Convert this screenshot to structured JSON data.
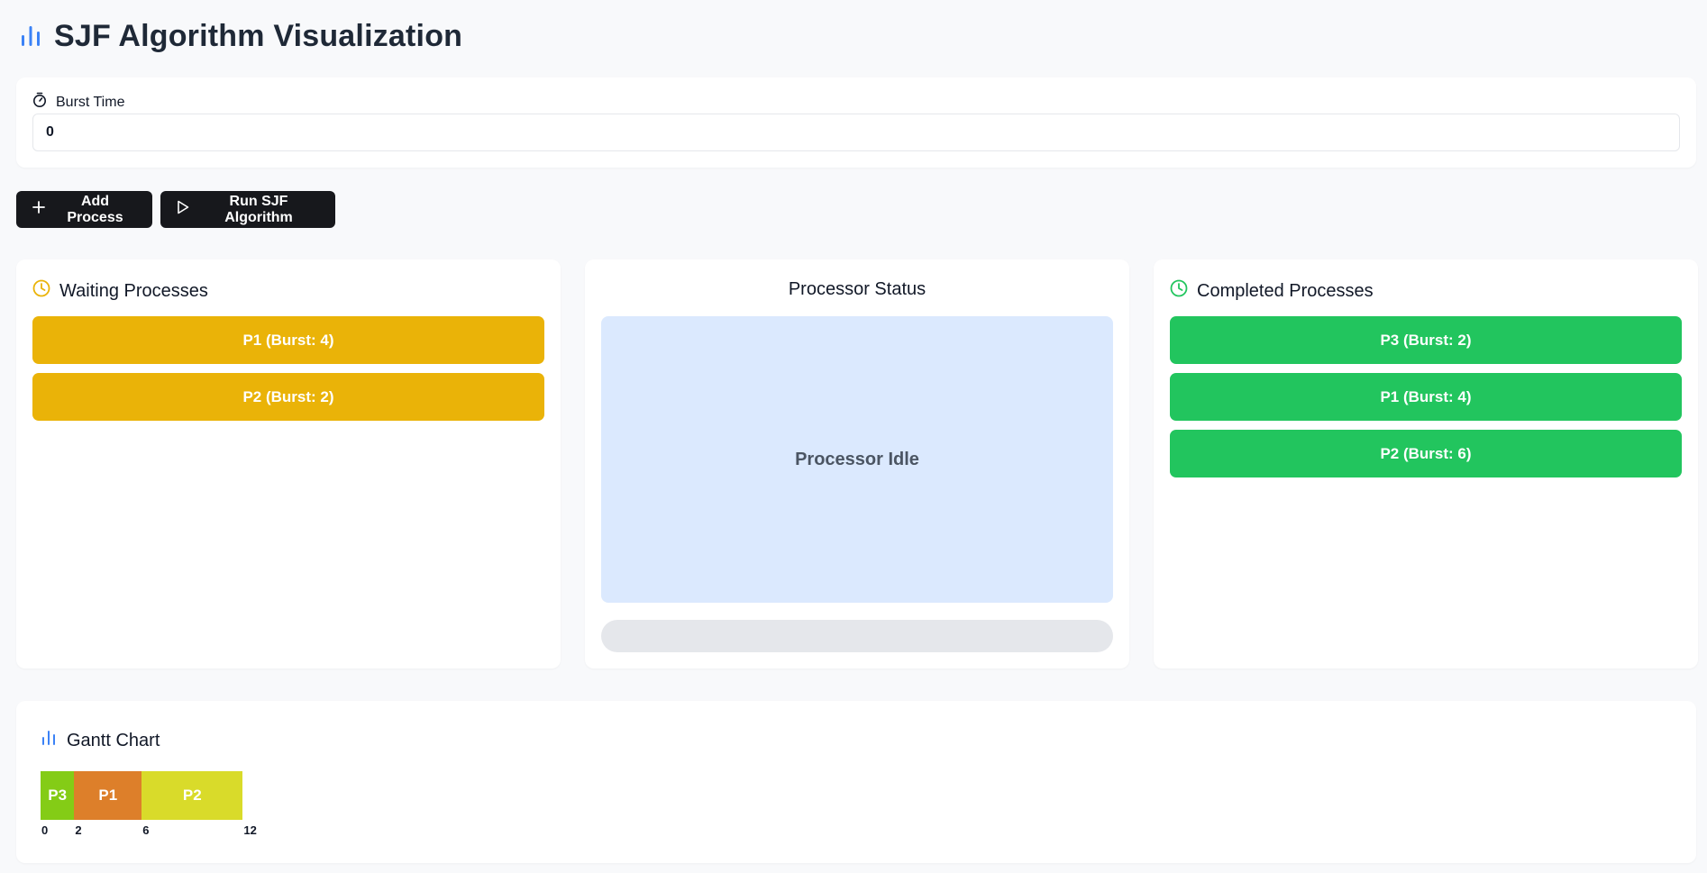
{
  "header": {
    "title": "SJF Algorithm Visualization",
    "icon": "bar-chart-icon"
  },
  "burst_input": {
    "label": "Burst Time",
    "value": "0",
    "icon": "timer-icon"
  },
  "buttons": {
    "add_label": "Add Process",
    "run_label": "Run SJF Algorithm"
  },
  "waiting": {
    "title": "Waiting Processes",
    "color": "#eab308",
    "items": [
      {
        "label": "P1 (Burst: 4)"
      },
      {
        "label": "P2 (Burst: 2)"
      }
    ]
  },
  "processor": {
    "title": "Processor Status",
    "status": "Processor Idle",
    "progress": 0
  },
  "completed": {
    "title": "Completed Processes",
    "color": "#22c55e",
    "items": [
      {
        "label": "P3 (Burst: 2)"
      },
      {
        "label": "P1 (Burst: 4)"
      },
      {
        "label": "P2 (Burst: 6)"
      }
    ]
  },
  "gantt": {
    "title": "Gantt Chart"
  },
  "chart_data": {
    "type": "gantt",
    "title": "Gantt Chart",
    "segments": [
      {
        "label": "P3",
        "start": 0,
        "end": 2,
        "color": "#84cc16"
      },
      {
        "label": "P1",
        "start": 2,
        "end": 6,
        "color": "#dd7f2a"
      },
      {
        "label": "P2",
        "start": 6,
        "end": 12,
        "color": "#d9db2a"
      }
    ],
    "ticks": [
      "0",
      "2",
      "6",
      "12"
    ]
  }
}
